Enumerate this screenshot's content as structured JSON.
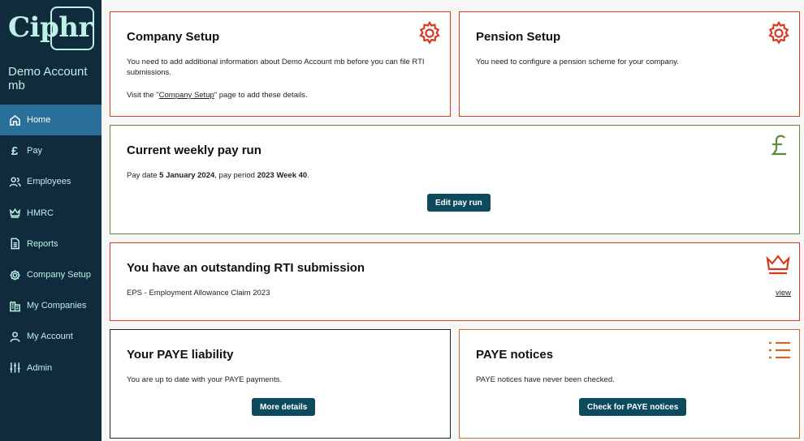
{
  "brand": {
    "logo": "Ciphr"
  },
  "account": {
    "name": "Demo Account mb"
  },
  "nav": {
    "items": [
      {
        "label": "Home",
        "icon": "home-icon"
      },
      {
        "label": "Pay",
        "icon": "pound-icon"
      },
      {
        "label": "Employees",
        "icon": "people-icon"
      },
      {
        "label": "HMRC",
        "icon": "crown-icon"
      },
      {
        "label": "Reports",
        "icon": "document-icon"
      },
      {
        "label": "Company Setup",
        "icon": "gear-icon"
      },
      {
        "label": "My Companies",
        "icon": "buildings-icon"
      },
      {
        "label": "My Account",
        "icon": "user-icon"
      },
      {
        "label": "Admin",
        "icon": "sliders-icon"
      }
    ],
    "active": "Home"
  },
  "cards": {
    "company_setup": {
      "title": "Company Setup",
      "text": "You need to add additional information about Demo Account mb before you can file RTI submissions.",
      "visit_prefix": "Visit the \"",
      "link": "Company Setup",
      "visit_suffix": "\" page to add these details.",
      "icon": "gear-icon"
    },
    "pension_setup": {
      "title": "Pension Setup",
      "text": "You need to configure a pension scheme for your company.",
      "icon": "gear-icon"
    },
    "pay_run": {
      "title": "Current weekly pay run",
      "date_prefix": "Pay date ",
      "date": "5 January 2024",
      "period_prefix": ", pay period ",
      "period": "2023 Week 40",
      "period_suffix": ".",
      "button": "Edit pay run",
      "icon": "pound-icon"
    },
    "rti": {
      "title": "You have an outstanding RTI submission",
      "item": "EPS - Employment Allowance Claim 2023",
      "link": "view",
      "icon": "crown-icon"
    },
    "paye_liability": {
      "title": "Your PAYE liability",
      "text": "You are up to date with your PAYE payments.",
      "button": "More details"
    },
    "paye_notices": {
      "title": "PAYE notices",
      "text": "PAYE notices have never been checked.",
      "button": "Check for PAYE notices",
      "icon": "list-icon"
    }
  },
  "colors": {
    "sidebar_bg": "#0f2b3c",
    "active_nav": "#2b6f9b",
    "alert_red": "#d8391f",
    "success_green": "#5a8d3a",
    "notice_orange": "#d06a2a",
    "button_bg": "#0d4a5e"
  }
}
